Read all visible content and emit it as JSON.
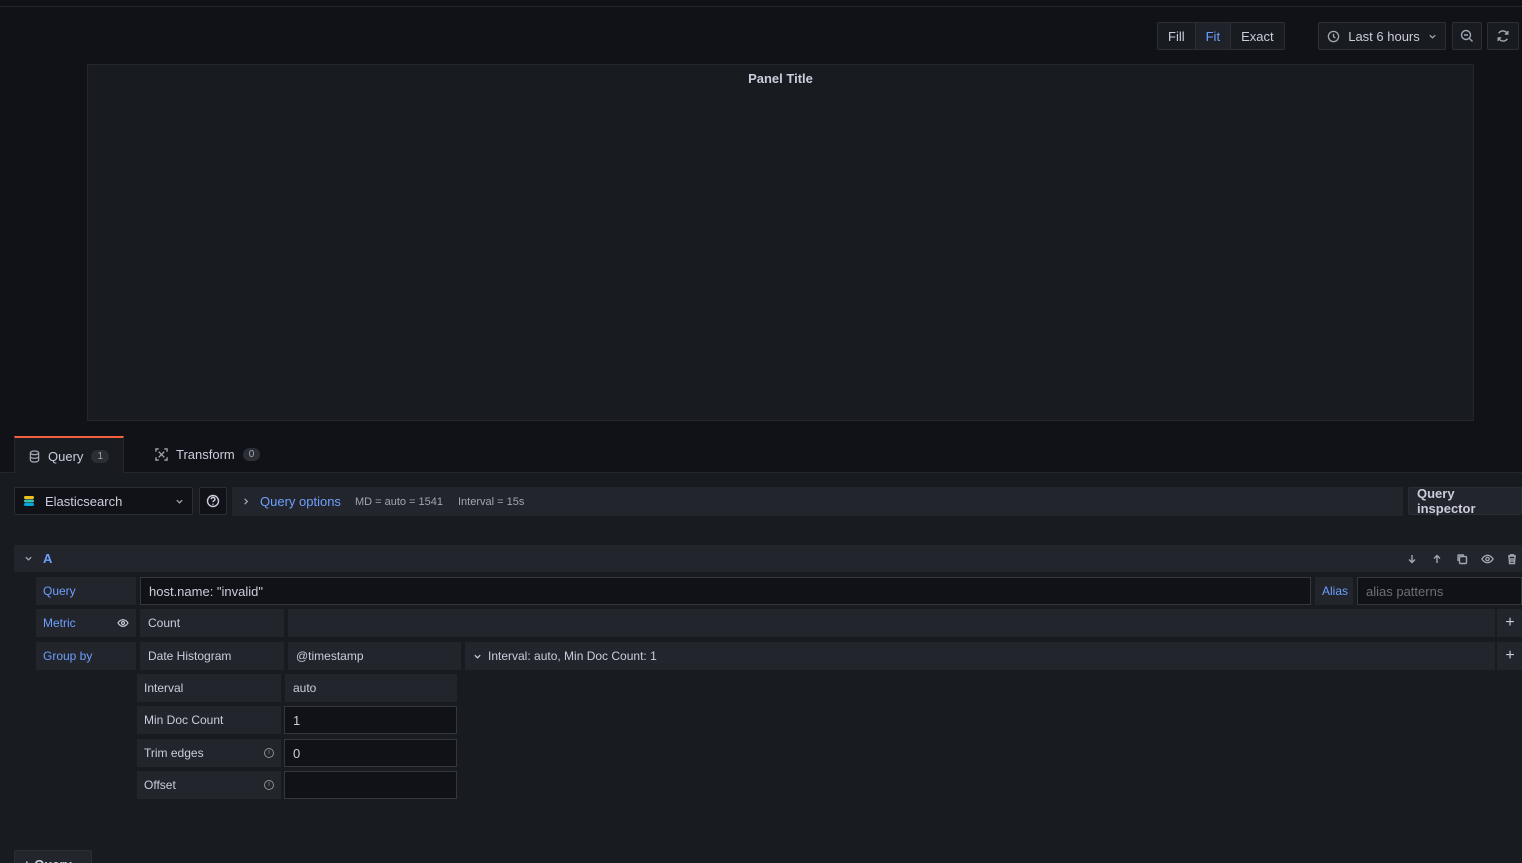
{
  "toolbar": {
    "fill": "Fill",
    "fit": "Fit",
    "exact": "Exact",
    "time_range": "Last 6 hours"
  },
  "panel": {
    "title": "Panel Title"
  },
  "tabs": [
    {
      "label": "Query",
      "count": "1"
    },
    {
      "label": "Transform",
      "count": "0"
    }
  ],
  "datasource": {
    "name": "Elasticsearch"
  },
  "query_options": {
    "title": "Query options",
    "md": "MD = auto = 1541",
    "interval": "Interval = 15s"
  },
  "query_inspector": "Query inspector",
  "query_row": {
    "ref": "A",
    "query_label": "Query",
    "query_value": "host.name: \"invalid\"",
    "alias_label": "Alias",
    "alias_placeholder": "alias patterns",
    "metric_label": "Metric",
    "metric_value": "Count",
    "groupby_label": "Group by",
    "groupby_type": "Date Histogram",
    "groupby_field": "@timestamp",
    "groupby_summary": "Interval: auto, Min Doc Count: 1",
    "settings": {
      "interval_label": "Interval",
      "interval_value": "auto",
      "min_doc_label": "Min Doc Count",
      "min_doc_value": "1",
      "trim_label": "Trim edges",
      "trim_value": "0",
      "offset_label": "Offset",
      "offset_value": ""
    }
  },
  "add_query": "+ Query",
  "colors": {
    "accent": "#6e9fff",
    "tab_active": "#f55f3e",
    "bg": "#111217"
  }
}
